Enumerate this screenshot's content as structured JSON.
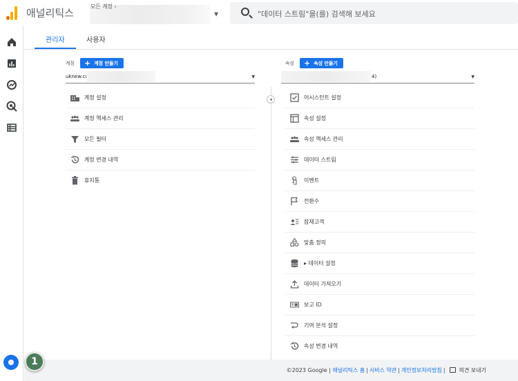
{
  "app": {
    "title": "애널리틱스"
  },
  "account_picker": {
    "label": "모든 계정 ›"
  },
  "search": {
    "placeholder": "\"데이터 스트림\"을(를) 검색해 보세요"
  },
  "tabs": [
    {
      "label": "관리자",
      "active": true
    },
    {
      "label": "사용자",
      "active": false
    }
  ],
  "account_column": {
    "label": "계정",
    "create_button": "계정 만들기",
    "selected_value": "uknew.cc",
    "items": [
      {
        "label": "계정 설정",
        "icon": "account-settings-icon"
      },
      {
        "label": "계정 액세스 관리",
        "icon": "people-icon"
      },
      {
        "label": "모든 필터",
        "icon": "filter-icon"
      },
      {
        "label": "계정 변경 내역",
        "icon": "history-icon"
      },
      {
        "label": "휴지통",
        "icon": "trash-icon"
      }
    ]
  },
  "property_column": {
    "label": "속성",
    "create_button": "속성 만들기",
    "selected_value": "4)",
    "items": [
      {
        "label": "어시스턴트 설정",
        "icon": "checkbox-icon"
      },
      {
        "label": "속성 설정",
        "icon": "property-settings-icon"
      },
      {
        "label": "속성 액세스 관리",
        "icon": "people-icon"
      },
      {
        "label": "데이터 스트림",
        "icon": "stream-icon"
      },
      {
        "label": "이벤트",
        "icon": "touch-icon"
      },
      {
        "label": "전환수",
        "icon": "flag-icon"
      },
      {
        "label": "잠재고객",
        "icon": "audience-icon"
      },
      {
        "label": "맞춤 정의",
        "icon": "shapes-icon"
      },
      {
        "label": "▸ 데이터 설정",
        "icon": "database-icon"
      },
      {
        "label": "데이터 가져오기",
        "icon": "upload-icon"
      },
      {
        "label": "보고 ID",
        "icon": "id-icon"
      },
      {
        "label": "기여 분석 설정",
        "icon": "attribution-icon"
      },
      {
        "label": "속성 변경 내역",
        "icon": "history-icon"
      }
    ]
  },
  "footer": {
    "copyright": "©2023 Google |",
    "links": [
      "애널리틱스 홈",
      "서비스 약관",
      "개인정보처리방침"
    ],
    "feedback": "의견 보내기"
  },
  "badge": {
    "text": "1"
  },
  "colors": {
    "accent": "#1a73e8",
    "logo_orange": "#f9ab00",
    "logo_dark": "#e37400",
    "badge": "#4a7c59"
  }
}
